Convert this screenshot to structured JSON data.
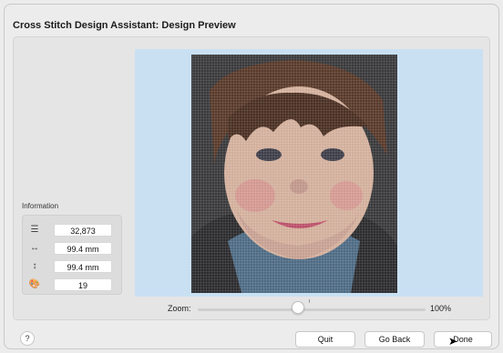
{
  "window": {
    "title": "Cross Stitch Design Assistant: Design Preview"
  },
  "information": {
    "label": "Information",
    "rows": [
      {
        "icon": "stitch-count-icon",
        "value": "32,873"
      },
      {
        "icon": "width-icon",
        "value": "99.4 mm"
      },
      {
        "icon": "height-icon",
        "value": "99.4 mm"
      },
      {
        "icon": "palette-icon",
        "value": "19"
      }
    ]
  },
  "preview": {
    "background": "#c9e0f3",
    "image": "cross-stitch portrait of a child"
  },
  "zoom": {
    "label": "Zoom:",
    "value": "100%"
  },
  "buttons": {
    "help": "?",
    "quit": "Quit",
    "go_back": "Go Back",
    "done": "Done"
  }
}
